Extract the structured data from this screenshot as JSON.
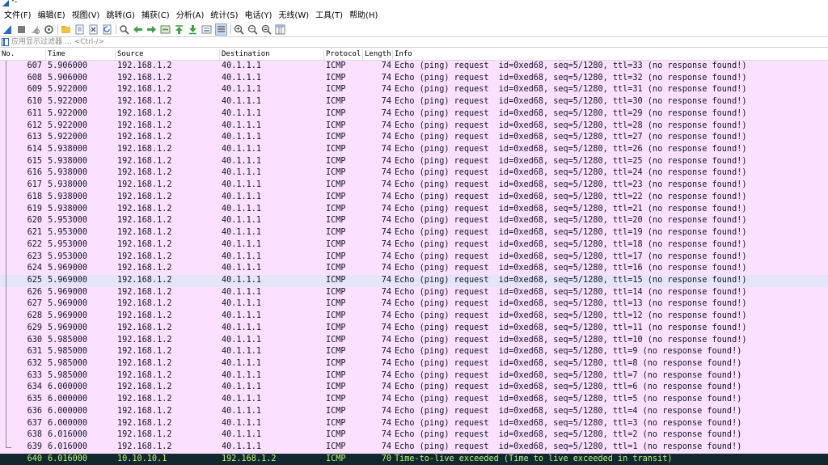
{
  "window": {
    "title": "*-"
  },
  "menu": [
    "文件(F)",
    "编辑(E)",
    "视图(V)",
    "跳转(G)",
    "捕获(C)",
    "分析(A)",
    "统计(S)",
    "电话(Y)",
    "无线(W)",
    "工具(T)",
    "帮助(H)"
  ],
  "toolbar": {
    "icons": [
      "shark-fin-start-icon",
      "stop-icon",
      "restart-icon",
      "options-gear-icon",
      "open-folder-icon",
      "save-file-icon",
      "close-file-icon",
      "reload-icon",
      "find-icon",
      "back-arrow-icon",
      "forward-arrow-icon",
      "go-to-packet-icon",
      "first-packet-icon",
      "last-packet-icon",
      "autoscroll-icon",
      "colorize-icon",
      "zoom-in-icon",
      "zoom-out-icon",
      "zoom-normal-icon",
      "resize-columns-icon"
    ]
  },
  "filter": {
    "placeholder": "应用显示过滤器 … <Ctrl-/>"
  },
  "columns": {
    "no": "No.",
    "time": "Time",
    "source": "Source",
    "destination": "Destination",
    "protocol": "Protocol",
    "length": "Length",
    "info": "Info"
  },
  "packets": [
    {
      "no": "607",
      "time": "5.906000",
      "source": "192.168.1.2",
      "destination": "40.1.1.1",
      "protocol": "ICMP",
      "length": "74",
      "info": "Echo (ping) request  id=0xed68, seq=5/1280, ttl=33 (no response found!)"
    },
    {
      "no": "608",
      "time": "5.906000",
      "source": "192.168.1.2",
      "destination": "40.1.1.1",
      "protocol": "ICMP",
      "length": "74",
      "info": "Echo (ping) request  id=0xed68, seq=5/1280, ttl=32 (no response found!)"
    },
    {
      "no": "609",
      "time": "5.922000",
      "source": "192.168.1.2",
      "destination": "40.1.1.1",
      "protocol": "ICMP",
      "length": "74",
      "info": "Echo (ping) request  id=0xed68, seq=5/1280, ttl=31 (no response found!)"
    },
    {
      "no": "610",
      "time": "5.922000",
      "source": "192.168.1.2",
      "destination": "40.1.1.1",
      "protocol": "ICMP",
      "length": "74",
      "info": "Echo (ping) request  id=0xed68, seq=5/1280, ttl=30 (no response found!)"
    },
    {
      "no": "611",
      "time": "5.922000",
      "source": "192.168.1.2",
      "destination": "40.1.1.1",
      "protocol": "ICMP",
      "length": "74",
      "info": "Echo (ping) request  id=0xed68, seq=5/1280, ttl=29 (no response found!)"
    },
    {
      "no": "612",
      "time": "5.922000",
      "source": "192.168.1.2",
      "destination": "40.1.1.1",
      "protocol": "ICMP",
      "length": "74",
      "info": "Echo (ping) request  id=0xed68, seq=5/1280, ttl=28 (no response found!)"
    },
    {
      "no": "613",
      "time": "5.922000",
      "source": "192.168.1.2",
      "destination": "40.1.1.1",
      "protocol": "ICMP",
      "length": "74",
      "info": "Echo (ping) request  id=0xed68, seq=5/1280, ttl=27 (no response found!)"
    },
    {
      "no": "614",
      "time": "5.938000",
      "source": "192.168.1.2",
      "destination": "40.1.1.1",
      "protocol": "ICMP",
      "length": "74",
      "info": "Echo (ping) request  id=0xed68, seq=5/1280, ttl=26 (no response found!)"
    },
    {
      "no": "615",
      "time": "5.938000",
      "source": "192.168.1.2",
      "destination": "40.1.1.1",
      "protocol": "ICMP",
      "length": "74",
      "info": "Echo (ping) request  id=0xed68, seq=5/1280, ttl=25 (no response found!)"
    },
    {
      "no": "616",
      "time": "5.938000",
      "source": "192.168.1.2",
      "destination": "40.1.1.1",
      "protocol": "ICMP",
      "length": "74",
      "info": "Echo (ping) request  id=0xed68, seq=5/1280, ttl=24 (no response found!)"
    },
    {
      "no": "617",
      "time": "5.938000",
      "source": "192.168.1.2",
      "destination": "40.1.1.1",
      "protocol": "ICMP",
      "length": "74",
      "info": "Echo (ping) request  id=0xed68, seq=5/1280, ttl=23 (no response found!)"
    },
    {
      "no": "618",
      "time": "5.938000",
      "source": "192.168.1.2",
      "destination": "40.1.1.1",
      "protocol": "ICMP",
      "length": "74",
      "info": "Echo (ping) request  id=0xed68, seq=5/1280, ttl=22 (no response found!)"
    },
    {
      "no": "619",
      "time": "5.938000",
      "source": "192.168.1.2",
      "destination": "40.1.1.1",
      "protocol": "ICMP",
      "length": "74",
      "info": "Echo (ping) request  id=0xed68, seq=5/1280, ttl=21 (no response found!)"
    },
    {
      "no": "620",
      "time": "5.953000",
      "source": "192.168.1.2",
      "destination": "40.1.1.1",
      "protocol": "ICMP",
      "length": "74",
      "info": "Echo (ping) request  id=0xed68, seq=5/1280, ttl=20 (no response found!)"
    },
    {
      "no": "621",
      "time": "5.953000",
      "source": "192.168.1.2",
      "destination": "40.1.1.1",
      "protocol": "ICMP",
      "length": "74",
      "info": "Echo (ping) request  id=0xed68, seq=5/1280, ttl=19 (no response found!)"
    },
    {
      "no": "622",
      "time": "5.953000",
      "source": "192.168.1.2",
      "destination": "40.1.1.1",
      "protocol": "ICMP",
      "length": "74",
      "info": "Echo (ping) request  id=0xed68, seq=5/1280, ttl=18 (no response found!)"
    },
    {
      "no": "623",
      "time": "5.953000",
      "source": "192.168.1.2",
      "destination": "40.1.1.1",
      "protocol": "ICMP",
      "length": "74",
      "info": "Echo (ping) request  id=0xed68, seq=5/1280, ttl=17 (no response found!)"
    },
    {
      "no": "624",
      "time": "5.969000",
      "source": "192.168.1.2",
      "destination": "40.1.1.1",
      "protocol": "ICMP",
      "length": "74",
      "info": "Echo (ping) request  id=0xed68, seq=5/1280, ttl=16 (no response found!)"
    },
    {
      "no": "625",
      "time": "5.969000",
      "source": "192.168.1.2",
      "destination": "40.1.1.1",
      "protocol": "ICMP",
      "length": "74",
      "info": "Echo (ping) request  id=0xed68, seq=5/1280, ttl=15 (no response found!)"
    },
    {
      "no": "626",
      "time": "5.969000",
      "source": "192.168.1.2",
      "destination": "40.1.1.1",
      "protocol": "ICMP",
      "length": "74",
      "info": "Echo (ping) request  id=0xed68, seq=5/1280, ttl=14 (no response found!)"
    },
    {
      "no": "627",
      "time": "5.969000",
      "source": "192.168.1.2",
      "destination": "40.1.1.1",
      "protocol": "ICMP",
      "length": "74",
      "info": "Echo (ping) request  id=0xed68, seq=5/1280, ttl=13 (no response found!)"
    },
    {
      "no": "628",
      "time": "5.969000",
      "source": "192.168.1.2",
      "destination": "40.1.1.1",
      "protocol": "ICMP",
      "length": "74",
      "info": "Echo (ping) request  id=0xed68, seq=5/1280, ttl=12 (no response found!)"
    },
    {
      "no": "629",
      "time": "5.969000",
      "source": "192.168.1.2",
      "destination": "40.1.1.1",
      "protocol": "ICMP",
      "length": "74",
      "info": "Echo (ping) request  id=0xed68, seq=5/1280, ttl=11 (no response found!)"
    },
    {
      "no": "630",
      "time": "5.985000",
      "source": "192.168.1.2",
      "destination": "40.1.1.1",
      "protocol": "ICMP",
      "length": "74",
      "info": "Echo (ping) request  id=0xed68, seq=5/1280, ttl=10 (no response found!)"
    },
    {
      "no": "631",
      "time": "5.985000",
      "source": "192.168.1.2",
      "destination": "40.1.1.1",
      "protocol": "ICMP",
      "length": "74",
      "info": "Echo (ping) request  id=0xed68, seq=5/1280, ttl=9 (no response found!)"
    },
    {
      "no": "632",
      "time": "5.985000",
      "source": "192.168.1.2",
      "destination": "40.1.1.1",
      "protocol": "ICMP",
      "length": "74",
      "info": "Echo (ping) request  id=0xed68, seq=5/1280, ttl=8 (no response found!)"
    },
    {
      "no": "633",
      "time": "5.985000",
      "source": "192.168.1.2",
      "destination": "40.1.1.1",
      "protocol": "ICMP",
      "length": "74",
      "info": "Echo (ping) request  id=0xed68, seq=5/1280, ttl=7 (no response found!)"
    },
    {
      "no": "634",
      "time": "6.000000",
      "source": "192.168.1.2",
      "destination": "40.1.1.1",
      "protocol": "ICMP",
      "length": "74",
      "info": "Echo (ping) request  id=0xed68, seq=5/1280, ttl=6 (no response found!)"
    },
    {
      "no": "635",
      "time": "6.000000",
      "source": "192.168.1.2",
      "destination": "40.1.1.1",
      "protocol": "ICMP",
      "length": "74",
      "info": "Echo (ping) request  id=0xed68, seq=5/1280, ttl=5 (no response found!)"
    },
    {
      "no": "636",
      "time": "6.000000",
      "source": "192.168.1.2",
      "destination": "40.1.1.1",
      "protocol": "ICMP",
      "length": "74",
      "info": "Echo (ping) request  id=0xed68, seq=5/1280, ttl=4 (no response found!)"
    },
    {
      "no": "637",
      "time": "6.000000",
      "source": "192.168.1.2",
      "destination": "40.1.1.1",
      "protocol": "ICMP",
      "length": "74",
      "info": "Echo (ping) request  id=0xed68, seq=5/1280, ttl=3 (no response found!)"
    },
    {
      "no": "638",
      "time": "6.016000",
      "source": "192.168.1.2",
      "destination": "40.1.1.1",
      "protocol": "ICMP",
      "length": "74",
      "info": "Echo (ping) request  id=0xed68, seq=5/1280, ttl=2 (no response found!)"
    },
    {
      "no": "639",
      "time": "6.016000",
      "source": "192.168.1.2",
      "destination": "40.1.1.1",
      "protocol": "ICMP",
      "length": "74",
      "info": "Echo (ping) request  id=0xed68, seq=5/1280, ttl=1 (no response found!)"
    },
    {
      "no": "640",
      "time": "6.016000",
      "source": "10.10.10.1",
      "destination": "192.168.1.2",
      "protocol": "ICMP",
      "length": "70",
      "info": "Time-to-live exceeded (Time to live exceeded in transit)"
    }
  ],
  "state": {
    "hover_row_no": "625",
    "selected_row_no": "640"
  },
  "colors": {
    "icmp_row": "#fce0ff",
    "hover_row": "#e4e6f8",
    "selected_row_bg": "#12272e",
    "selected_row_text": "#b7f774",
    "row_text": "#12122a"
  }
}
